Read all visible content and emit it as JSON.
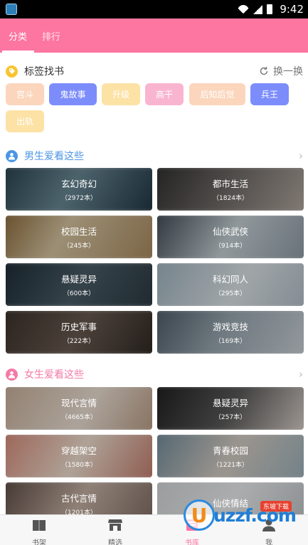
{
  "status_bar": {
    "time": "9:42"
  },
  "top_tabs": [
    {
      "label": "分类",
      "active": true
    },
    {
      "label": "排行",
      "active": false
    }
  ],
  "tag_section": {
    "title": "标签找书",
    "refresh_label": "换一换",
    "tags": [
      {
        "label": "宫斗",
        "bg": "#fbd6bd",
        "fg": "#ffffff"
      },
      {
        "label": "鬼故事",
        "bg": "#7c8dfb",
        "fg": "#ffffff"
      },
      {
        "label": "升级",
        "bg": "#fde2a6",
        "fg": "#ffffff"
      },
      {
        "label": "高干",
        "bg": "#f9b5cf",
        "fg": "#ffffff"
      },
      {
        "label": "后知后觉",
        "bg": "#fbd6bd",
        "fg": "#ffffff"
      },
      {
        "label": "兵王",
        "bg": "#7c8dfb",
        "fg": "#ffffff"
      },
      {
        "label": "出轨",
        "bg": "#fde2a6",
        "fg": "#ffffff"
      }
    ]
  },
  "male_section": {
    "title": "男生爱看这些",
    "accent": "#4b96e3",
    "cards": [
      {
        "name": "玄幻奇幻",
        "count": "（2972本）",
        "bg": "linear-gradient(120deg,#27414f,#6b8a97 45%,#1d3340)"
      },
      {
        "name": "都市生活",
        "count": "（1824本）",
        "bg": "linear-gradient(120deg,#2e2e2e,#7a7470 55%,#b6aca4)"
      },
      {
        "name": "校园生活",
        "count": "（245本）",
        "bg": "linear-gradient(120deg,#8c6a3a,#d9c7a3 40%,#a9895e)"
      },
      {
        "name": "仙侠武侠",
        "count": "（914本）",
        "bg": "linear-gradient(120deg,#3b4750,#c8d3d8 50%,#8c9aa3)"
      },
      {
        "name": "悬疑灵异",
        "count": "（600本）",
        "bg": "linear-gradient(120deg,#1c2b35,#4b5d67 50%,#2a3842)"
      },
      {
        "name": "科幻同人",
        "count": "（295本）",
        "bg": "linear-gradient(120deg,#9fb4c0,#dfe6ea 55%,#b3c1ca)"
      },
      {
        "name": "历史军事",
        "count": "（222本）",
        "bg": "linear-gradient(120deg,#3a3029,#6a5b51 50%,#2d2723)"
      },
      {
        "name": "游戏竞技",
        "count": "（169本）",
        "bg": "linear-gradient(120deg,#4a5a66,#9aa8b2 45%,#cfd6db)"
      }
    ]
  },
  "female_section": {
    "title": "女生爱看这些",
    "accent": "#f47aa6",
    "cards": [
      {
        "name": "现代言情",
        "count": "（4665本）",
        "bg": "linear-gradient(120deg,#c9b09a,#efe3d7 55%,#b99b83)"
      },
      {
        "name": "悬疑灵异",
        "count": "（257本）",
        "bg": "linear-gradient(120deg,#1d1d1d,#5a5a5a 50%,#e3d9d2)"
      },
      {
        "name": "穿越架空",
        "count": "（1580本）",
        "bg": "linear-gradient(120deg,#d98a78,#f2e1d2 50%,#c47a6a)"
      },
      {
        "name": "青春校园",
        "count": "（1221本）",
        "bg": "linear-gradient(120deg,#6f8c9c,#d8cfc6 50%,#9cb3bd)"
      },
      {
        "name": "古代言情",
        "count": "（1201本）",
        "bg": "linear-gradient(120deg,#5b4a44,#c8b3a5 50%,#7c6a62)"
      },
      {
        "name": "仙侠情结",
        "count": "",
        "bg": "linear-gradient(120deg,#d5d8da,#eef0f1 50%,#bfc5c9)"
      }
    ]
  },
  "bottom_nav": [
    {
      "label": "书架",
      "icon": "bookshelf-icon",
      "active": false
    },
    {
      "label": "精选",
      "icon": "store-icon",
      "active": false
    },
    {
      "label": "书库",
      "icon": "library-icon",
      "active": true
    },
    {
      "label": "我",
      "icon": "user-icon",
      "active": false
    }
  ],
  "watermark": {
    "text": "uzzf.com",
    "badge": "东坡下载",
    "letter": "U"
  }
}
